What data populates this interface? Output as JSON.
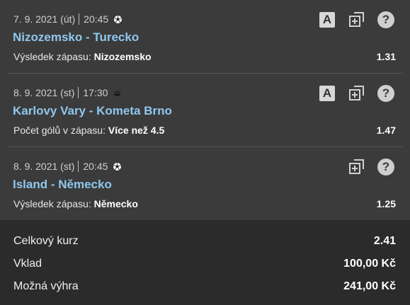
{
  "bets": [
    {
      "date": "7. 9. 2021 (út)",
      "time": "20:45",
      "sport_icon": "football-icon",
      "match": "Nizozemsko - Turecko",
      "market_label": "Výsledek zápasu:",
      "selection": "Nizozemsko",
      "odds": "1.31",
      "has_a_icon": true
    },
    {
      "date": "8. 9. 2021 (st)",
      "time": "17:30",
      "sport_icon": "hockey-puck-icon",
      "match": "Karlovy Vary - Kometa Brno",
      "market_label": "Počet gólů v zápasu:",
      "selection": "Více než 4.5",
      "odds": "1.47",
      "has_a_icon": true
    },
    {
      "date": "8. 9. 2021 (st)",
      "time": "20:45",
      "sport_icon": "football-icon",
      "match": "Island - Německo",
      "market_label": "Výsledek zápasu:",
      "selection": "Německo",
      "odds": "1.25",
      "has_a_icon": false
    }
  ],
  "icons": {
    "a_label": "A",
    "help_label": "?"
  },
  "summary": {
    "total_odds_label": "Celkový kurz",
    "total_odds_value": "2.41",
    "stake_label": "Vklad",
    "stake_value": "100,00 Kč",
    "win_label": "Možná výhra",
    "win_value": "241,00 Kč"
  },
  "colors": {
    "background": "#3b3b3b",
    "summary_background": "#2b2b2b",
    "match_link": "#8fc7ee"
  }
}
